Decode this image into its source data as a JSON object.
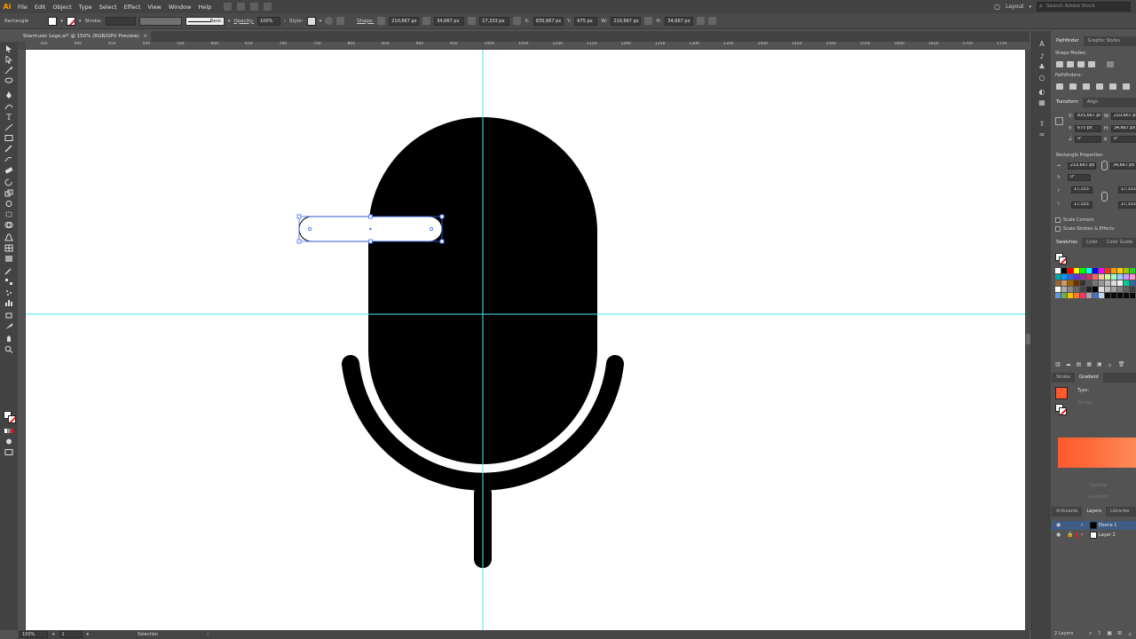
{
  "app": {
    "logo": "Ai"
  },
  "menu": [
    "File",
    "Edit",
    "Object",
    "Type",
    "Select",
    "Effect",
    "View",
    "Window",
    "Help"
  ],
  "menubar_right": {
    "layout": "Layout",
    "search_placeholder": "Search Adobe Stock"
  },
  "control_bar": {
    "object_type": "Rectangle",
    "stroke_label": "Stroke:",
    "stroke_profile": "Basic",
    "opacity_label": "Opacity:",
    "opacity_value": "100%",
    "style_label": "Style:",
    "shape_label": "Shape:",
    "shape_width": "210,667 px",
    "shape_height": "34,667 px",
    "corner_radius": "17,333 px",
    "x_label": "X:",
    "x_value": "835,667 px",
    "y_label": "Y:",
    "y_value": "675 px",
    "w_label": "W:",
    "w_value": "210,667 px",
    "h_label": "H:",
    "h_value": "34,667 px"
  },
  "document": {
    "tab_title": "Starmusic Logo.ai* @ 150% (RGB/GPU Preview)",
    "close": "×"
  },
  "ruler_h": [
    "350",
    "400",
    "450",
    "500",
    "550",
    "600",
    "650",
    "700",
    "750",
    "800",
    "850",
    "900",
    "950",
    "1000",
    "1050",
    "1100",
    "1150",
    "1200",
    "1250",
    "1300",
    "1350",
    "1400",
    "1450",
    "1500",
    "1550",
    "1600",
    "1650",
    "1700",
    "1750",
    "1800"
  ],
  "status": {
    "zoom": "150%",
    "artboard": "1",
    "tool": "Selection"
  },
  "panels": {
    "pathfinder_tabs": [
      "Pathfinder",
      "Graphic Styles"
    ],
    "shape_modes": "Shape Modes:",
    "pathfinders": "Pathfinders:",
    "transform_tabs": [
      "Transform",
      "Align"
    ],
    "x_label": "X:",
    "x_value": "835,667 px",
    "w_label": "W:",
    "w_value": "210,667 px",
    "y_label": "Y:",
    "y_value": "675 px",
    "h_label": "H:",
    "h_value": "34,667 px",
    "angle": "0°",
    "shear": "0°",
    "rect_props": "Rectangle Properties:",
    "rect_w": "210,667 px",
    "rect_h": "34,667 px",
    "rect_angle": "0°",
    "corner_a": "17,333",
    "corner_b": "17,333",
    "corner_c": "17,333",
    "corner_d": "17,333",
    "scale_corners": "Scale Corners",
    "scale_strokes": "Scale Strokes & Effects",
    "swatch_tabs": [
      "Swatches",
      "Color",
      "Color Guide"
    ],
    "stroke_gradient_tabs": [
      "Stroke",
      "Gradient"
    ],
    "type_label": "Type:",
    "stroke_label": "Stroke:",
    "opacity_label": "Opacity:",
    "location_label": "Location:",
    "layers_tabs": [
      "Artboards",
      "Layers",
      "Libraries"
    ],
    "layers": [
      "Ebene 1",
      "Layer 2"
    ],
    "layers_count": "2 Layers"
  },
  "colors": {
    "app_bg": "#535353",
    "canvas": "#ffffff",
    "guide": "#4fe3f0",
    "selection": "#3d6dff",
    "gradient": "#ff5a2e"
  },
  "swatches": [
    "#ffffff",
    "#000000",
    "#ff0000",
    "#ffff00",
    "#00ff00",
    "#00ffff",
    "#0000ff",
    "#ff00ff",
    "#ff3300",
    "#ff9900",
    "#ffcc00",
    "#99cc00",
    "#33cc33",
    "#009966",
    "#00aaaa",
    "#0099ff",
    "#3366cc",
    "#6633cc",
    "#993399",
    "#cc3366",
    "#ff6666",
    "#ffcc99",
    "#ccff99",
    "#99ffcc",
    "#99ccff",
    "#cc99ff",
    "#ff99cc",
    "#cccccc",
    "#996633",
    "#cc9966",
    "#996600",
    "#663300",
    "#333333",
    "#555555",
    "#777777",
    "#999999",
    "#bbbbbb",
    "#dddddd",
    "#f2f2f2",
    "#00cc99",
    "#336699",
    "#cc6600",
    "#ffffff",
    "#aaaaaa",
    "#888888",
    "#666666",
    "#444444",
    "#222222",
    "#000000",
    "#e0e0e0",
    "#c0c0c0",
    "#a0a0a0",
    "#808080",
    "#606060",
    "#404040",
    "#202020",
    "#5b9bd5",
    "#70ad47",
    "#ffc000",
    "#ed7d31",
    "#ff3366",
    "#a5a5a5",
    "#4472c4",
    "#bdd7ee",
    "#0a0a0a",
    "#0a0a0a",
    "#0a0a0a",
    "#0a0a0a",
    "#0a0a0a",
    "#0a0a0a"
  ]
}
